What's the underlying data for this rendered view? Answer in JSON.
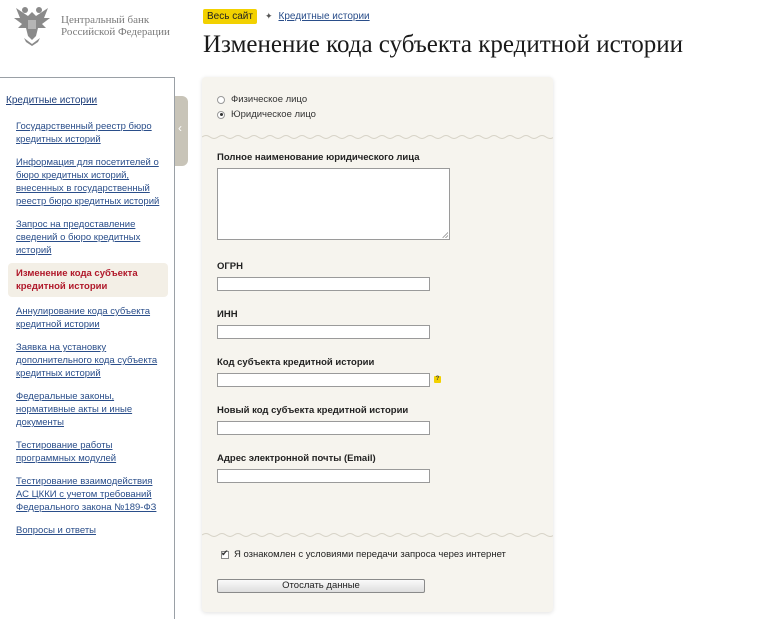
{
  "logo": {
    "line1": "Центральный банк",
    "line2": "Российской Федерации",
    "emblem_icon": "double-headed-eagle-icon"
  },
  "top": {
    "all_site": "Весь сайт",
    "separator_icon": "diamond-icon",
    "breadcrumb": "Кредитные истории"
  },
  "page_title": "Изменение кода субъекта кредитной истории",
  "sidebar": {
    "heading": "Кредитные истории",
    "items": [
      {
        "label": "Государственный реестр бюро кредитных историй"
      },
      {
        "label": "Информация для посетителей о бюро кредитных историй, внесенных в государственный реестр бюро кредитных историй"
      },
      {
        "label": "Запрос на предоставление сведений о бюро кредитных историй"
      },
      {
        "label": "Изменение кода субъекта кредитной истории"
      },
      {
        "label": "Аннулирование кода субъекта кредитной истории"
      },
      {
        "label": "Заявка на установку дополнительного кода субъекта кредитных историй"
      },
      {
        "label": "Федеральные законы, нормативные акты и иные документы"
      },
      {
        "label": "Тестирование работы программных модулей"
      },
      {
        "label": "Тестирование взаимодействия АС ЦККИ с учетом требований Федерального закона №189-ФЗ"
      },
      {
        "label": "Вопросы и ответы"
      }
    ],
    "collapse_icon": "chevron-left-icon"
  },
  "form": {
    "radio_individual": "Физическое лицо",
    "radio_legal": "Юридическое лицо",
    "selected": "Юридическое лицо",
    "full_name_label": "Полное наименование юридического лица",
    "full_name_value": "",
    "ogrn_label": "ОГРН",
    "ogrn_value": "",
    "inn_label": "ИНН",
    "inn_value": "",
    "code_label": "Код субъекта кредитной истории",
    "code_value": "",
    "help_icon": "question-mark-icon",
    "new_code_label": "Новый код субъекта кредитной истории",
    "new_code_value": "",
    "email_label": "Адрес электронной почты (Email)",
    "email_value": "",
    "agree_label": "Я ознакомлен с условиями передачи запроса через интернет",
    "agree_checked": true,
    "submit_label": "Отослать данные"
  },
  "colors": {
    "accent_yellow": "#f2d100",
    "link_blue": "#2a4e8a",
    "active_red": "#b0182a",
    "panel_bg": "#f6f4ee"
  }
}
